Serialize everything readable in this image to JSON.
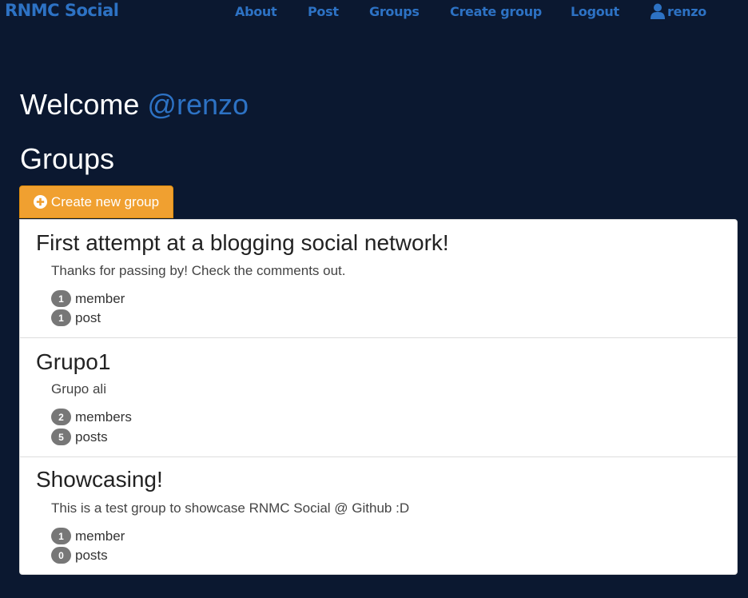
{
  "nav": {
    "brand": "RNMC Social",
    "links": [
      "About",
      "Post",
      "Groups",
      "Create group",
      "Logout"
    ],
    "user": "renzo",
    "link_color": "#2d72c4"
  },
  "welcome": {
    "prefix": "Welcome",
    "handle": "@renzo"
  },
  "groups_heading": "Groups",
  "create_button": {
    "label": "Create new group",
    "icon": "plus-circle-icon",
    "color": "#f0a030"
  },
  "groups": [
    {
      "name": "First attempt at a blogging social network!",
      "description": "Thanks for passing by! Check the comments out.",
      "members_count": "1",
      "members_label": "member",
      "posts_count": "1",
      "posts_label": "post"
    },
    {
      "name": "Grupo1",
      "description": "Grupo ali",
      "members_count": "2",
      "members_label": "members",
      "posts_count": "5",
      "posts_label": "posts"
    },
    {
      "name": "Showcasing!",
      "description": "This is a test group to showcase RNMC Social @ Github :D",
      "members_count": "1",
      "members_label": "member",
      "posts_count": "0",
      "posts_label": "posts"
    }
  ],
  "colors": {
    "background": "#0b1830",
    "badge": "#777777"
  }
}
